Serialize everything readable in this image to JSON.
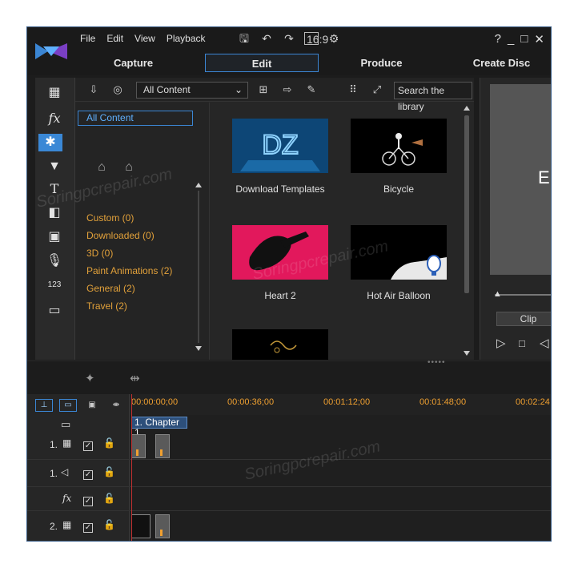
{
  "menu": [
    "File",
    "Edit",
    "View",
    "Playback"
  ],
  "toolbar": {
    "aspect_label": "16:9"
  },
  "window_controls": [
    "?",
    "_",
    "□",
    "✕"
  ],
  "tabs": [
    {
      "label": "Capture"
    },
    {
      "label": "Edit",
      "active": true
    },
    {
      "label": "Produce"
    },
    {
      "label": "Create Disc"
    }
  ],
  "library": {
    "filter_value": "All Content",
    "search_placeholder": "Search the library",
    "tree_selected": "All Content",
    "tags": [
      "Custom  (0)",
      "Downloaded  (0)",
      "3D  (0)",
      "Paint Animations  (2)",
      "General  (2)",
      "Travel  (2)"
    ],
    "items": [
      {
        "label": "Download Templates",
        "icon": "dz-logo"
      },
      {
        "label": "Bicycle",
        "icon": "cyclist"
      },
      {
        "label": "Heart 2",
        "icon": "paint-splash"
      },
      {
        "label": "Hot Air Balloon",
        "icon": "balloon"
      }
    ]
  },
  "preview": {
    "clip_label": "Clip",
    "screen_letter": "E"
  },
  "timeline": {
    "ruler": [
      "00:00:00;00",
      "00:00:36;00",
      "00:01:12;00",
      "00:01:48;00",
      "00:02:24"
    ],
    "chapter_label": "1. Chapter 1",
    "tracks": [
      {
        "label": "1.",
        "kind": "video"
      },
      {
        "label": "1.",
        "kind": "audio"
      },
      {
        "label": "fx",
        "kind": "effect"
      },
      {
        "label": "2.",
        "kind": "video"
      }
    ]
  },
  "watermark": "Soringpcrepair.com",
  "colors": {
    "accent": "#3b86d4",
    "tag_text": "#e2a13a",
    "ruler_text": "#f0a030",
    "playhead": "#c23030"
  }
}
